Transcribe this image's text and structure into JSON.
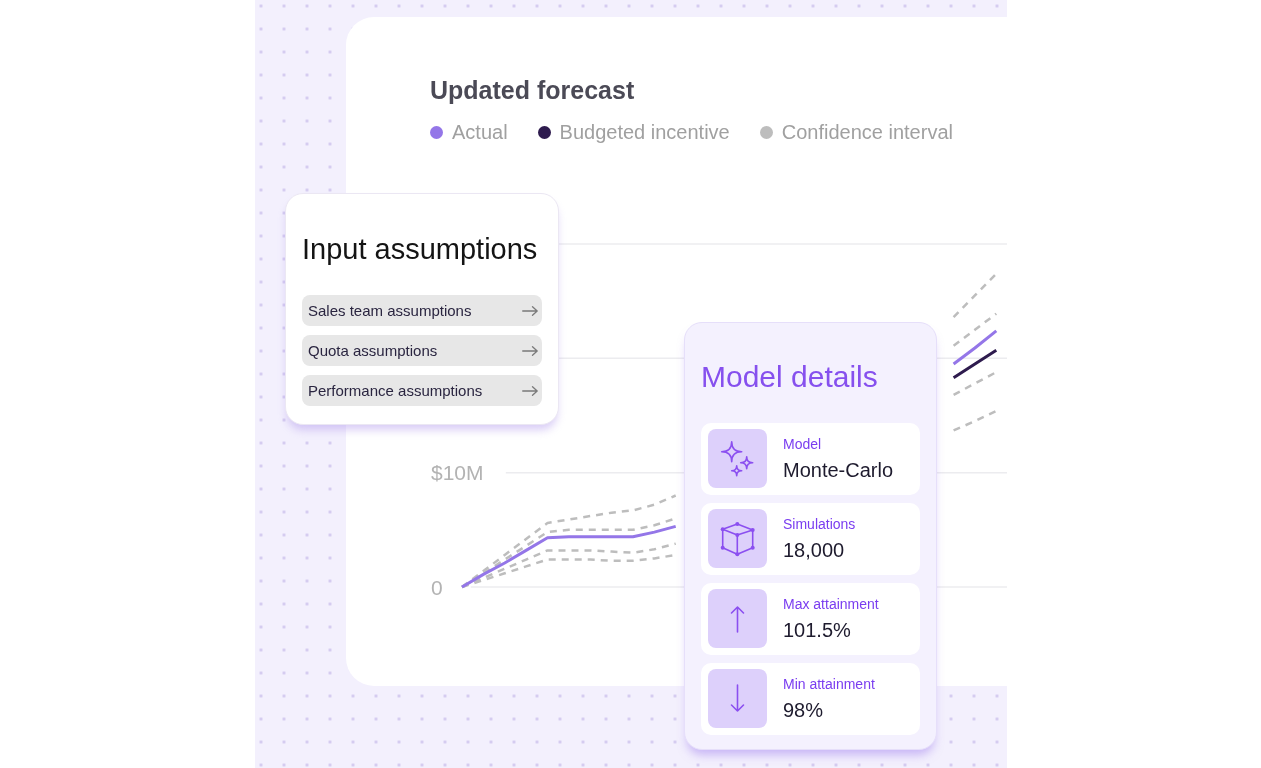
{
  "forecast": {
    "chart_data": [
      {
        "type": "line",
        "title": "Updated forecast",
        "legend": "top",
        "categories": [
          null,
          null,
          null,
          null,
          null,
          null,
          null,
          null,
          null,
          null,
          null,
          null,
          null,
          null,
          null,
          null,
          null,
          null,
          null,
          null,
          null,
          null,
          null,
          null,
          null,
          null
        ],
        "ylim": [
          0,
          30
        ],
        "yticks": [
          {
            "value": 0,
            "label": "0"
          },
          {
            "value": 10,
            "label": "$10M"
          }
        ],
        "tick_labels": "y",
        "grid": true,
        "series": [
          {
            "name": "Actual",
            "color": "#9476e8",
            "values": [
              0,
              1.1,
              2.1,
              3.2,
              4.3,
              4.4,
              4.4,
              4.4,
              4.4,
              4.8,
              5.3,
              null,
              null,
              null,
              null,
              null,
              null,
              null,
              null,
              null,
              null,
              null,
              null,
              19.5,
              20.9,
              22.4
            ]
          },
          {
            "name": "Budgeted incentive",
            "color": "#2e1b4e",
            "values": [
              null,
              null,
              null,
              null,
              null,
              null,
              null,
              null,
              null,
              null,
              null,
              null,
              null,
              null,
              null,
              null,
              null,
              null,
              null,
              null,
              null,
              null,
              null,
              18.3,
              19.5,
              20.7
            ]
          },
          {
            "name": "Confidence interval",
            "color": "#bdbdbd",
            "line_style": "dashed",
            "values": [
              0,
              1.4,
              2.8,
              4.2,
              5.6,
              5.9,
              6.2,
              6.5,
              6.7,
              7.2,
              8.0,
              null,
              null,
              null,
              null,
              null,
              null,
              null,
              null,
              null,
              null,
              null,
              null,
              23.6,
              25.5,
              27.4
            ]
          },
          {
            "color": "#bdbdbd",
            "line_style": "dashed",
            "values": [
              0,
              1.2,
              2.4,
              3.6,
              4.8,
              5.0,
              5.0,
              5.0,
              5.0,
              5.4,
              6.0,
              null,
              null,
              null,
              null,
              null,
              null,
              null,
              null,
              null,
              null,
              null,
              null,
              21.1,
              22.5,
              23.9
            ]
          },
          {
            "color": "#bdbdbd",
            "line_style": "dashed",
            "values": [
              0,
              0.8,
              1.6,
              2.4,
              3.2,
              3.2,
              3.2,
              3.1,
              3.0,
              3.3,
              3.8,
              null,
              null,
              null,
              null,
              null,
              null,
              null,
              null,
              null,
              null,
              null,
              null,
              16.8,
              17.8,
              18.8
            ]
          },
          {
            "color": "#bdbdbd",
            "line_style": "dashed",
            "values": [
              0,
              0.6,
              1.2,
              1.8,
              2.4,
              2.4,
              2.4,
              2.3,
              2.3,
              2.5,
              2.8,
              null,
              null,
              null,
              null,
              null,
              null,
              null,
              null,
              null,
              null,
              null,
              null,
              13.7,
              14.5,
              15.4
            ]
          }
        ]
      }
    ]
  },
  "input_assumptions": {
    "title": "Input assumptions",
    "items": [
      {
        "label": "Sales team assumptions"
      },
      {
        "label": "Quota assumptions"
      },
      {
        "label": "Performance assumptions"
      }
    ]
  },
  "model_details": {
    "title": "Model details",
    "rows": [
      {
        "label": "Model",
        "value": "Monte-Carlo"
      },
      {
        "label": "Simulations",
        "value": "18,000"
      },
      {
        "label": "Max attainment",
        "value": "101.5%"
      },
      {
        "label": "Min attainment",
        "value": "98%"
      }
    ]
  }
}
